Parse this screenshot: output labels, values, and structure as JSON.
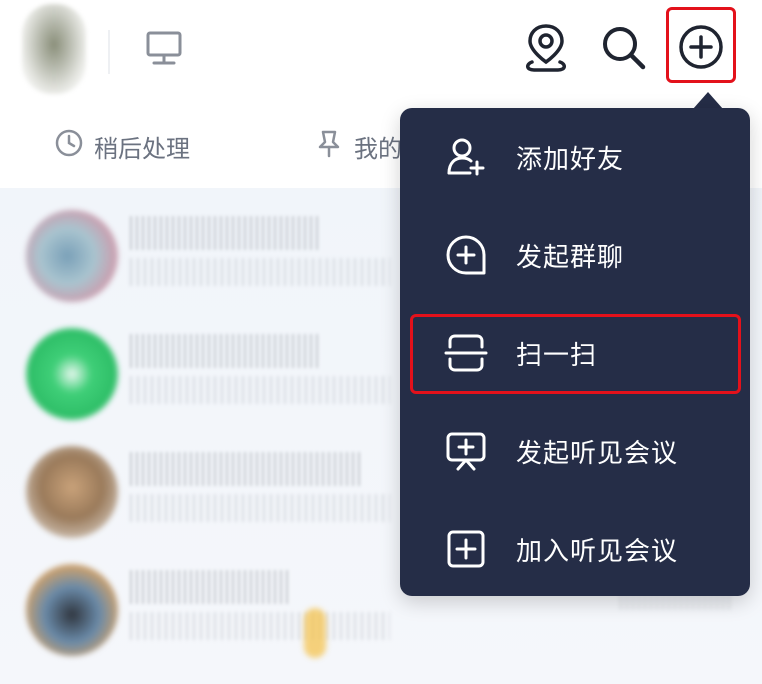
{
  "header": {
    "icons": [
      "desktop-icon",
      "location-icon",
      "search-icon",
      "plus-circle-icon"
    ]
  },
  "quick_tabs": [
    {
      "label": "稍后处理",
      "icon": "clock-icon"
    },
    {
      "label": "我的",
      "icon": "pin-icon"
    }
  ],
  "popup_menu": {
    "items": [
      {
        "label": "添加好友",
        "icon": "add-friend-icon"
      },
      {
        "label": "发起群聊",
        "icon": "group-chat-icon"
      },
      {
        "label": "扫一扫",
        "icon": "scan-icon"
      },
      {
        "label": "发起听见会议",
        "icon": "start-meeting-icon"
      },
      {
        "label": "加入听见会议",
        "icon": "join-meeting-icon"
      }
    ]
  },
  "colors": {
    "popup_bg": "#252d47",
    "highlight": "#e3111b",
    "chat_bg": "#f1f5fa"
  }
}
